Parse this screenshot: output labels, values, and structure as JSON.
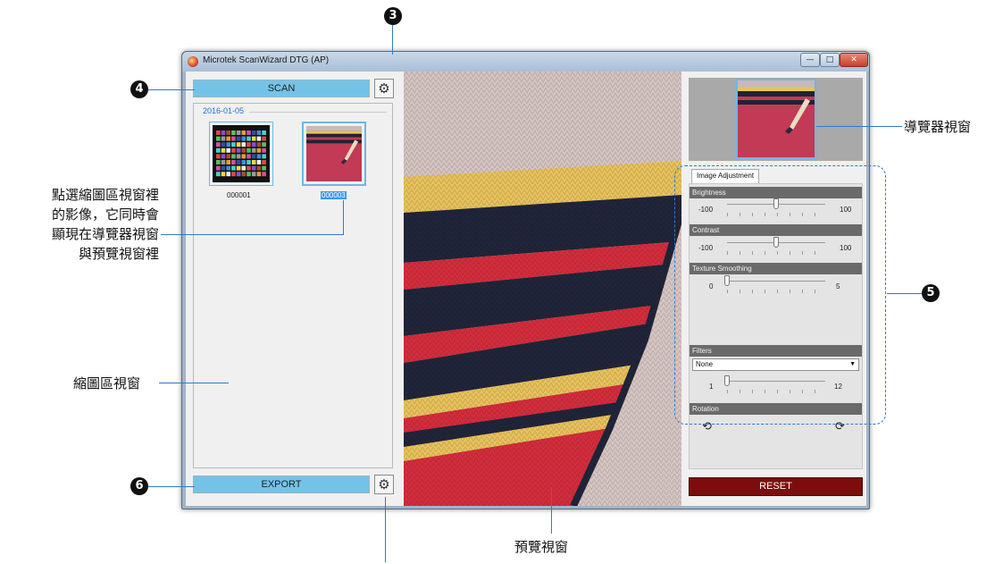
{
  "window": {
    "title": "Microtek ScanWizard DTG (AP)",
    "controls": {
      "minimize": "—",
      "maximize": "□",
      "close": "✕"
    }
  },
  "left_panel": {
    "scan_label": "SCAN",
    "export_label": "EXPORT",
    "settings_icon": "gear-icon",
    "date_group": "2016-01-05",
    "thumbnails": [
      {
        "caption": "000001",
        "selected": false
      },
      {
        "caption": "000003",
        "selected": true
      }
    ]
  },
  "right_panel": {
    "tab_label": "Image Adjustment",
    "brightness": {
      "label": "Brightness",
      "min": "-100",
      "max": "100",
      "value": 0
    },
    "contrast": {
      "label": "Contrast",
      "min": "-100",
      "max": "100",
      "value": 0
    },
    "texture_smoothing": {
      "label": "Texture Smoothing",
      "min": "0",
      "max": "5",
      "value": 0
    },
    "filters": {
      "label": "Filters",
      "selected": "None",
      "min": "1",
      "max": "12",
      "value": 1
    },
    "rotation": {
      "label": "Rotation",
      "left_icon": "rotate-left-icon",
      "right_icon": "rotate-right-icon"
    },
    "reset_label": "RESET"
  },
  "annotations": {
    "callout_3": "3",
    "callout_4": "4",
    "callout_5": "5",
    "callout_6": "6",
    "thumb_hint_line1": "點選縮圖區視窗裡",
    "thumb_hint_line2": "的影像，它同時會",
    "thumb_hint_line3": "顯現在導覽器視窗",
    "thumb_hint_line4": "與預覽視窗裡",
    "thumbnail_window": "縮圖區視窗",
    "navigator_window": "導覽器視窗",
    "preview_window": "預覽視窗"
  },
  "colors": {
    "button_blue": "#74c3e6",
    "reset_red": "#7d0d0d",
    "accent_line": "#2f7bc7",
    "stripe_yellow": "#e8c25c",
    "stripe_navy": "#20253a",
    "stripe_red": "#d42d3c"
  }
}
